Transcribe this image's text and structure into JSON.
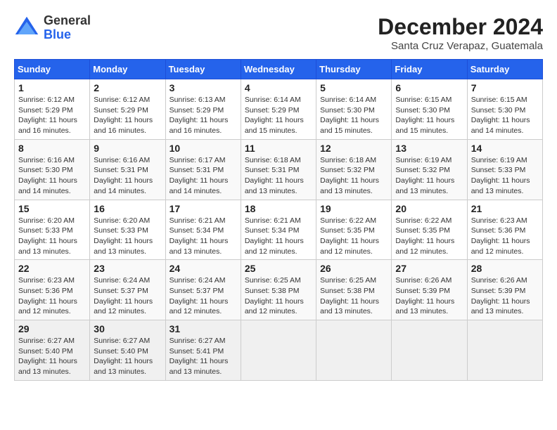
{
  "logo": {
    "general": "General",
    "blue": "Blue"
  },
  "title": {
    "month_year": "December 2024",
    "location": "Santa Cruz Verapaz, Guatemala"
  },
  "days_of_week": [
    "Sunday",
    "Monday",
    "Tuesday",
    "Wednesday",
    "Thursday",
    "Friday",
    "Saturday"
  ],
  "weeks": [
    [
      {
        "day": "1",
        "info": "Sunrise: 6:12 AM\nSunset: 5:29 PM\nDaylight: 11 hours and 16 minutes."
      },
      {
        "day": "2",
        "info": "Sunrise: 6:12 AM\nSunset: 5:29 PM\nDaylight: 11 hours and 16 minutes."
      },
      {
        "day": "3",
        "info": "Sunrise: 6:13 AM\nSunset: 5:29 PM\nDaylight: 11 hours and 16 minutes."
      },
      {
        "day": "4",
        "info": "Sunrise: 6:14 AM\nSunset: 5:29 PM\nDaylight: 11 hours and 15 minutes."
      },
      {
        "day": "5",
        "info": "Sunrise: 6:14 AM\nSunset: 5:30 PM\nDaylight: 11 hours and 15 minutes."
      },
      {
        "day": "6",
        "info": "Sunrise: 6:15 AM\nSunset: 5:30 PM\nDaylight: 11 hours and 15 minutes."
      },
      {
        "day": "7",
        "info": "Sunrise: 6:15 AM\nSunset: 5:30 PM\nDaylight: 11 hours and 14 minutes."
      }
    ],
    [
      {
        "day": "8",
        "info": "Sunrise: 6:16 AM\nSunset: 5:30 PM\nDaylight: 11 hours and 14 minutes."
      },
      {
        "day": "9",
        "info": "Sunrise: 6:16 AM\nSunset: 5:31 PM\nDaylight: 11 hours and 14 minutes."
      },
      {
        "day": "10",
        "info": "Sunrise: 6:17 AM\nSunset: 5:31 PM\nDaylight: 11 hours and 14 minutes."
      },
      {
        "day": "11",
        "info": "Sunrise: 6:18 AM\nSunset: 5:31 PM\nDaylight: 11 hours and 13 minutes."
      },
      {
        "day": "12",
        "info": "Sunrise: 6:18 AM\nSunset: 5:32 PM\nDaylight: 11 hours and 13 minutes."
      },
      {
        "day": "13",
        "info": "Sunrise: 6:19 AM\nSunset: 5:32 PM\nDaylight: 11 hours and 13 minutes."
      },
      {
        "day": "14",
        "info": "Sunrise: 6:19 AM\nSunset: 5:33 PM\nDaylight: 11 hours and 13 minutes."
      }
    ],
    [
      {
        "day": "15",
        "info": "Sunrise: 6:20 AM\nSunset: 5:33 PM\nDaylight: 11 hours and 13 minutes."
      },
      {
        "day": "16",
        "info": "Sunrise: 6:20 AM\nSunset: 5:33 PM\nDaylight: 11 hours and 13 minutes."
      },
      {
        "day": "17",
        "info": "Sunrise: 6:21 AM\nSunset: 5:34 PM\nDaylight: 11 hours and 13 minutes."
      },
      {
        "day": "18",
        "info": "Sunrise: 6:21 AM\nSunset: 5:34 PM\nDaylight: 11 hours and 12 minutes."
      },
      {
        "day": "19",
        "info": "Sunrise: 6:22 AM\nSunset: 5:35 PM\nDaylight: 11 hours and 12 minutes."
      },
      {
        "day": "20",
        "info": "Sunrise: 6:22 AM\nSunset: 5:35 PM\nDaylight: 11 hours and 12 minutes."
      },
      {
        "day": "21",
        "info": "Sunrise: 6:23 AM\nSunset: 5:36 PM\nDaylight: 11 hours and 12 minutes."
      }
    ],
    [
      {
        "day": "22",
        "info": "Sunrise: 6:23 AM\nSunset: 5:36 PM\nDaylight: 11 hours and 12 minutes."
      },
      {
        "day": "23",
        "info": "Sunrise: 6:24 AM\nSunset: 5:37 PM\nDaylight: 11 hours and 12 minutes."
      },
      {
        "day": "24",
        "info": "Sunrise: 6:24 AM\nSunset: 5:37 PM\nDaylight: 11 hours and 12 minutes."
      },
      {
        "day": "25",
        "info": "Sunrise: 6:25 AM\nSunset: 5:38 PM\nDaylight: 11 hours and 12 minutes."
      },
      {
        "day": "26",
        "info": "Sunrise: 6:25 AM\nSunset: 5:38 PM\nDaylight: 11 hours and 13 minutes."
      },
      {
        "day": "27",
        "info": "Sunrise: 6:26 AM\nSunset: 5:39 PM\nDaylight: 11 hours and 13 minutes."
      },
      {
        "day": "28",
        "info": "Sunrise: 6:26 AM\nSunset: 5:39 PM\nDaylight: 11 hours and 13 minutes."
      }
    ],
    [
      {
        "day": "29",
        "info": "Sunrise: 6:27 AM\nSunset: 5:40 PM\nDaylight: 11 hours and 13 minutes."
      },
      {
        "day": "30",
        "info": "Sunrise: 6:27 AM\nSunset: 5:40 PM\nDaylight: 11 hours and 13 minutes."
      },
      {
        "day": "31",
        "info": "Sunrise: 6:27 AM\nSunset: 5:41 PM\nDaylight: 11 hours and 13 minutes."
      },
      {
        "day": "",
        "info": ""
      },
      {
        "day": "",
        "info": ""
      },
      {
        "day": "",
        "info": ""
      },
      {
        "day": "",
        "info": ""
      }
    ]
  ]
}
